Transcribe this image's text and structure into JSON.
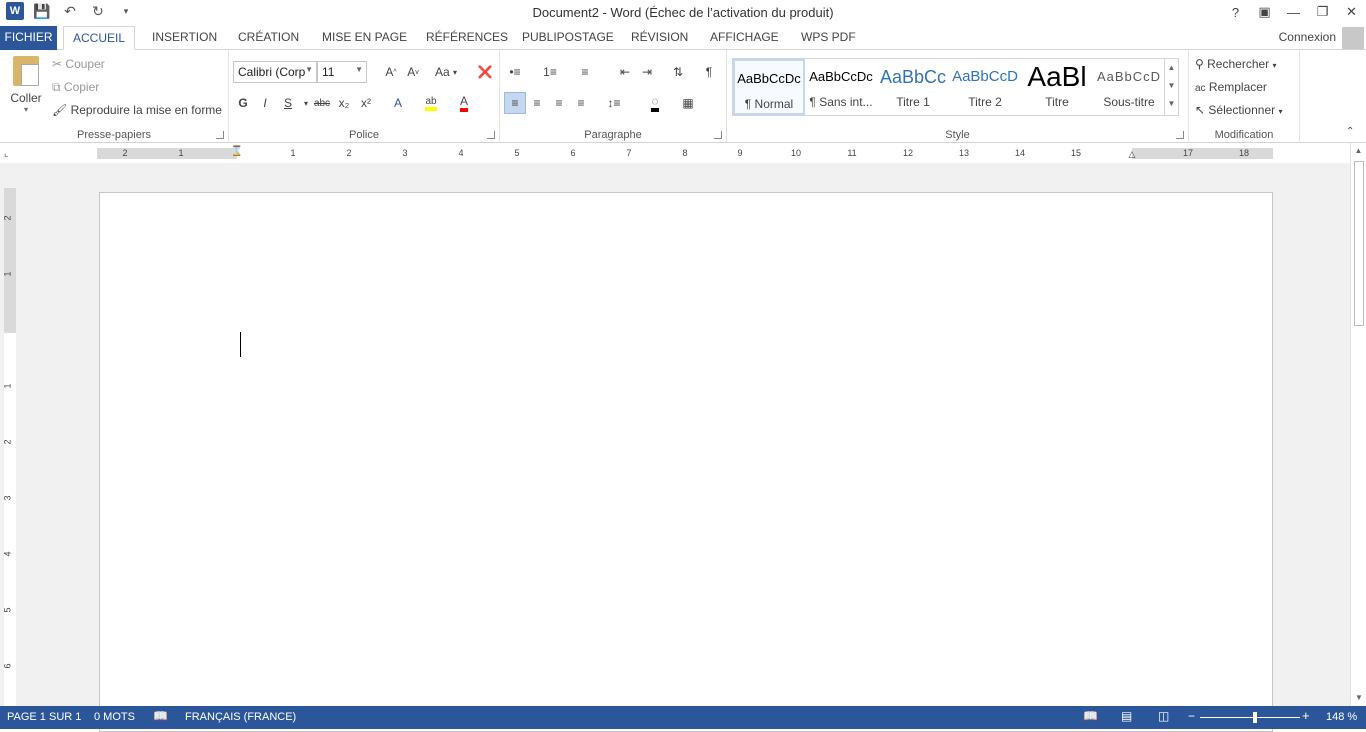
{
  "window": {
    "title": "Document2 - Word (Échec de l’activation du produit)",
    "help": "?",
    "signin": "Connexion"
  },
  "qat": {
    "logo": "W"
  },
  "tabs": [
    "FICHIER",
    "ACCUEIL",
    "INSERTION",
    "CRÉATION",
    "MISE EN PAGE",
    "RÉFÉRENCES",
    "PUBLIPOSTAGE",
    "RÉVISION",
    "AFFICHAGE",
    "WPS PDF"
  ],
  "active_tab": "ACCUEIL",
  "clipboard": {
    "paste": "Coller",
    "cut": "Couper",
    "copy": "Copier",
    "format_painter": "Reproduire la mise en forme",
    "label": "Presse-papiers"
  },
  "font": {
    "name": "Calibri (Corp",
    "size": "11",
    "label": "Police",
    "bold": "G",
    "italic": "I",
    "underline": "S",
    "strike": "abc",
    "sub": "x₂",
    "sup": "x²",
    "case": "Aa"
  },
  "paragraph": {
    "label": "Paragraphe",
    "pilcrow": "¶"
  },
  "styles": {
    "label": "Style",
    "items": [
      {
        "preview": "AaBbCcDc",
        "name": "¶ Normal"
      },
      {
        "preview": "AaBbCcDc",
        "name": "¶ Sans int..."
      },
      {
        "preview": "AaBbCc",
        "name": "Titre 1"
      },
      {
        "preview": "AaBbCcD",
        "name": "Titre 2"
      },
      {
        "preview": "AaBl",
        "name": "Titre"
      },
      {
        "preview": "AaBbCcD",
        "name": "Sous-titre"
      }
    ]
  },
  "editing": {
    "find": "Rechercher",
    "replace": "Remplacer",
    "select": "Sélectionner",
    "label": "Modification"
  },
  "ruler": {
    "ticks": [
      "2",
      "1",
      "1",
      "2",
      "3",
      "4",
      "5",
      "6",
      "7",
      "8",
      "9",
      "10",
      "11",
      "12",
      "13",
      "14",
      "15",
      "17",
      "18"
    ]
  },
  "vruler": {
    "ticks": [
      "2",
      "1",
      "1",
      "2",
      "3",
      "4",
      "5",
      "6"
    ]
  },
  "status": {
    "page": "PAGE 1 SUR 1",
    "words": "0 MOTS",
    "language": "FRANÇAIS (FRANCE)",
    "zoom": "148 %"
  },
  "colors": {
    "accent": "#2b579a",
    "highlight": "#ffff00",
    "font_color": "#ff0000"
  }
}
